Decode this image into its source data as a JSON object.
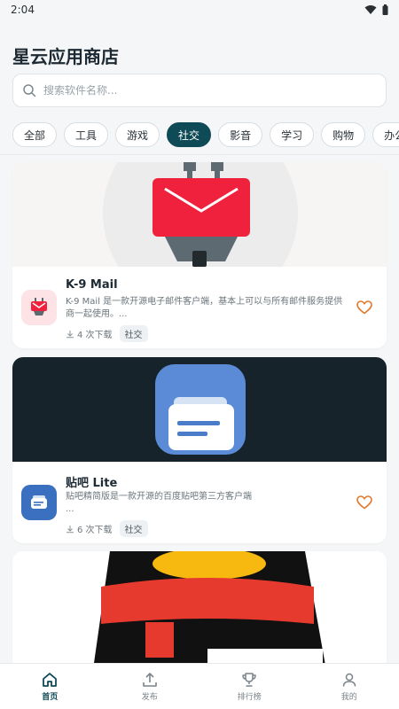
{
  "status": {
    "time": "2:04"
  },
  "header": {
    "title": "星云应用商店"
  },
  "search": {
    "placeholder": "搜索软件名称..."
  },
  "categories": [
    "全部",
    "工具",
    "游戏",
    "社交",
    "影音",
    "学习",
    "购物",
    "办公"
  ],
  "active_category": "社交",
  "apps": [
    {
      "name": "K-9 Mail",
      "description": "K-9 Mail 是一款开源电子邮件客户端，基本上可以与所有邮件服务提供商一起使用。...",
      "downloads": "4 次下载",
      "tag": "社交",
      "icon": "mail-robot-icon",
      "accent": "#f0213d"
    },
    {
      "name": "贴吧 Lite",
      "description": "贴吧精简版是一款开源的百度贴吧第三方客户端\n...",
      "downloads": "6 次下载",
      "tag": "社交",
      "icon": "chat-bubble-icon",
      "accent": "#5b8bd6"
    },
    {
      "name": "",
      "icon": "penguin-icon",
      "accent": "#e63a2e"
    }
  ],
  "nav": [
    {
      "label": "首页",
      "icon": "home-icon",
      "active": true
    },
    {
      "label": "发布",
      "icon": "upload-icon",
      "active": false
    },
    {
      "label": "排行榜",
      "icon": "trophy-icon",
      "active": false
    },
    {
      "label": "我的",
      "icon": "user-icon",
      "active": false
    }
  ],
  "colors": {
    "primary": "#0f4a57",
    "favorite": "#e07a2e",
    "background": "#f4f6f7"
  }
}
